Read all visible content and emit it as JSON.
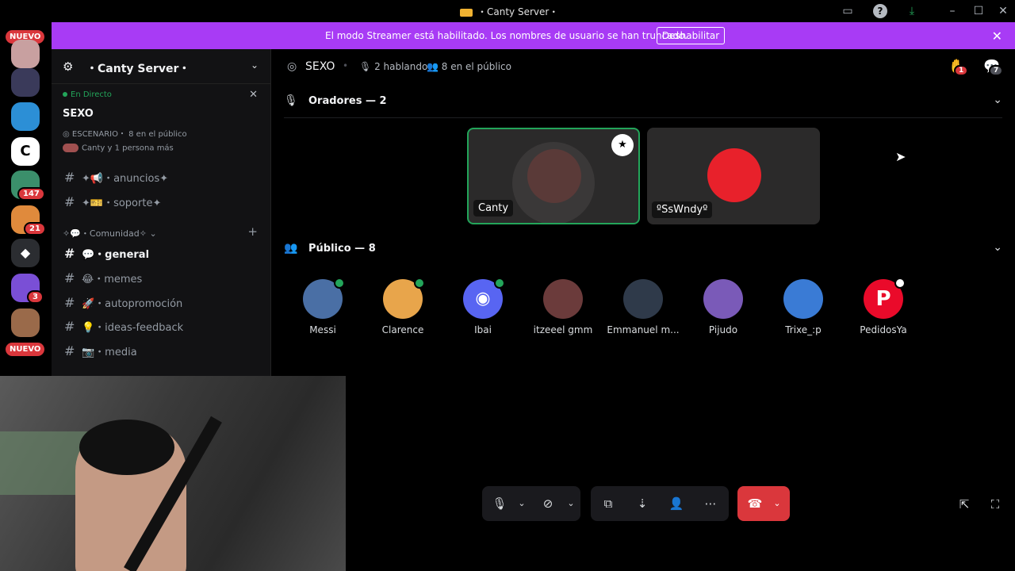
{
  "window": {
    "title": "・Canty Server・"
  },
  "banner": {
    "message": "El modo Streamer está habilitado. Los nombres de usuario se han truncado.",
    "button": "Deshabilitar"
  },
  "servers": {
    "new_badge_top": "NUEVO",
    "new_badge_bottom": "NUEVO",
    "badges": [
      "147",
      "21",
      "3"
    ]
  },
  "sidebar": {
    "server_name": "・Canty Server・",
    "live_label": "En Directo",
    "stage_name": "SEXO",
    "stage_meta": "ESCENARIO・ 8 en el público",
    "stage_people": "Canty y 1 persona más",
    "channels_top": [
      {
        "label": "✦📢・anuncios✦"
      },
      {
        "label": "✦🎫・soporte✦"
      }
    ],
    "category": "✧💬・Comunidad✧",
    "channels": [
      {
        "label": "💬・general"
      },
      {
        "label": "😂・memes"
      },
      {
        "label": "🚀・autopromoción"
      },
      {
        "label": "💡・ideas-feedback"
      },
      {
        "label": "📷・media"
      }
    ]
  },
  "stage_header": {
    "name": "SEXO",
    "speaking": "2 hablando",
    "audience": "8 en el público",
    "hand_badge": "1",
    "threads_badge": "7"
  },
  "speakers": {
    "header": "Oradores — 2",
    "items": [
      {
        "name": "Canty"
      },
      {
        "name": "ºSsWndyº"
      }
    ]
  },
  "audience": {
    "header": "Público — 8",
    "items": [
      {
        "name": "Messi",
        "color": "#4a6fa5"
      },
      {
        "name": "Clarence",
        "color": "#e8a54b"
      },
      {
        "name": "Ibai",
        "color": "#5865f2"
      },
      {
        "name": "itzeeel gmm",
        "color": "#6b3b3b"
      },
      {
        "name": "Emmanuel m...",
        "color": "#2f3a4a"
      },
      {
        "name": "Pijudo",
        "color": "#7a5ab8"
      },
      {
        "name": "Trixe_:p",
        "color": "#3a7bd5"
      },
      {
        "name": "PedidosYa",
        "color": "#ea0a2a"
      }
    ]
  },
  "colors": {
    "accent": "#a83bf5",
    "danger": "#da373c",
    "online": "#23a55a"
  }
}
